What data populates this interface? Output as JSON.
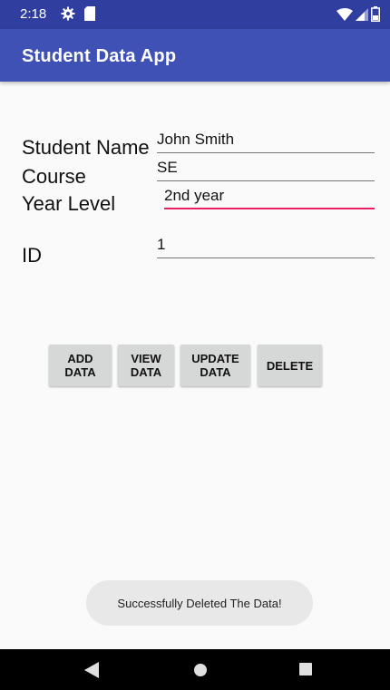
{
  "status_bar": {
    "time": "2:18",
    "icons": [
      "gear-icon",
      "sd-card-icon",
      "wifi-icon",
      "signal-icon",
      "battery-icon"
    ]
  },
  "app_bar": {
    "title": "Student Data App",
    "color": "#3f51b5",
    "status_color": "#303f9f"
  },
  "form": {
    "student_name_label": "Student Name",
    "student_name_value": "John Smith",
    "course_label": "Course",
    "course_value": "SE",
    "year_level_label": "Year Level",
    "year_level_value": "2nd year",
    "id_label": "ID",
    "id_value": "1",
    "focus_color": "#e91e63"
  },
  "buttons": {
    "add": "ADD\nDATA",
    "view": "VIEW\nDATA",
    "update": "UPDATE\nDATA",
    "delete": "DELETE"
  },
  "toast": {
    "message": "Successfully Deleted The Data!"
  },
  "nav_bar": {
    "icons": [
      "back-icon",
      "home-icon",
      "recent-apps-icon"
    ]
  }
}
